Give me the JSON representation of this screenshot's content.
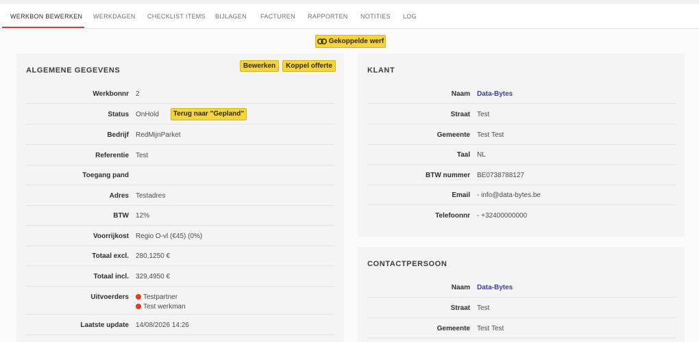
{
  "tabs": [
    {
      "label": "WERKBON BEWERKEN",
      "active": true
    },
    {
      "label": "WERKDAGEN"
    },
    {
      "label": "CHECKLIST ITEMS"
    },
    {
      "label": "BIJLAGEN"
    },
    {
      "label": "FACTUREN"
    },
    {
      "label": "RAPPORTEN"
    },
    {
      "label": "NOTITIES"
    },
    {
      "label": "LOG"
    }
  ],
  "linked_site_button": "Gekoppelde werf",
  "general": {
    "title": "ALGEMENE GEGEVENS",
    "edit_button": "Bewerken",
    "link_quote_button": "Koppel offerte",
    "rows": {
      "werkbonnr": {
        "label": "Werkbonnr",
        "value": "2"
      },
      "status": {
        "label": "Status",
        "value": "OnHold",
        "action": "Terug naar \"Gepland\""
      },
      "bedrijf": {
        "label": "Bedrijf",
        "value": "RedMijnParket"
      },
      "referentie": {
        "label": "Referentie",
        "value": "Test"
      },
      "toegang": {
        "label": "Toegang pand",
        "value": ""
      },
      "adres": {
        "label": "Adres",
        "value": "Testadres"
      },
      "btw": {
        "label": "BTW",
        "value": "12%"
      },
      "voorrijkost": {
        "label": "Voorrijkost",
        "value": "Regio O-vl (€45) (0%)"
      },
      "totaal_excl": {
        "label": "Totaal excl.",
        "value": "280,1250 €"
      },
      "totaal_incl": {
        "label": "Totaal incl.",
        "value": "329,4950 €"
      },
      "uitvoerders": {
        "label": "Uitvoerders",
        "values": [
          "Testpartner",
          "Test werkman"
        ]
      },
      "laatste_update": {
        "label": "Laatste update",
        "value": "14/08/2026 14:26"
      }
    }
  },
  "klant": {
    "title": "KLANT",
    "rows": {
      "naam": {
        "label": "Naam",
        "value": "Data-Bytes"
      },
      "straat": {
        "label": "Straat",
        "value": "Test"
      },
      "gemeente": {
        "label": "Gemeente",
        "value": "Test Test"
      },
      "taal": {
        "label": "Taal",
        "value": "NL"
      },
      "btw_nummer": {
        "label": "BTW nummer",
        "value": "BE0738788127"
      },
      "email": {
        "label": "Email",
        "value": "- info@data-bytes.be"
      },
      "telefoon": {
        "label": "Telefoonnr",
        "value": "- +32400000000"
      }
    }
  },
  "contact": {
    "title": "CONTACTPERSOON",
    "rows": {
      "naam": {
        "label": "Naam",
        "value": "Data-Bytes"
      },
      "straat": {
        "label": "Straat",
        "value": "Test"
      },
      "gemeente": {
        "label": "Gemeente",
        "value": "Test Test"
      }
    }
  },
  "colors": {
    "accent_yellow": "#f7d536",
    "tab_underline": "#d63a3a",
    "link": "#3b3f9a",
    "status_dot": "#e63b1c"
  },
  "icons": {
    "linked_site": "link-icon"
  }
}
